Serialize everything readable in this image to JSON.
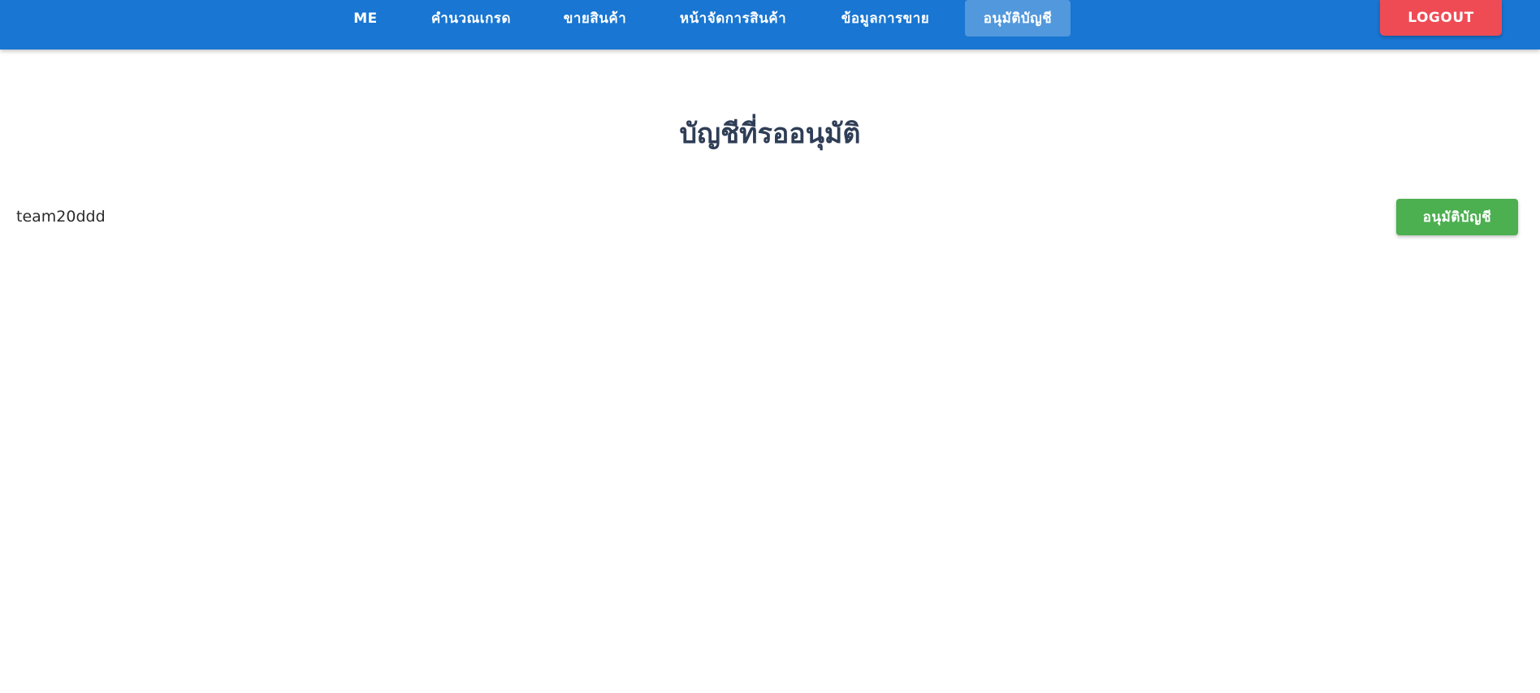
{
  "nav": {
    "items": [
      {
        "label": "ME"
      },
      {
        "label": "คำนวณเกรด"
      },
      {
        "label": "ขายสินค้า"
      },
      {
        "label": "หน้าจัดการสินค้า"
      },
      {
        "label": "ข้อมูลการขาย"
      },
      {
        "label": "อนุมัติบัญชี"
      }
    ],
    "active_index": 5,
    "logout_label": "LOGOUT"
  },
  "main": {
    "title": "บัญชีที่รออนุมัติ",
    "pending_accounts": [
      {
        "username": "team20ddd",
        "action_label": "อนุมัติบัญชี"
      }
    ]
  },
  "colors": {
    "topbar": "#1976d2",
    "logout": "#ef4b55",
    "approve": "#4caf50",
    "title": "#2f3e56"
  }
}
